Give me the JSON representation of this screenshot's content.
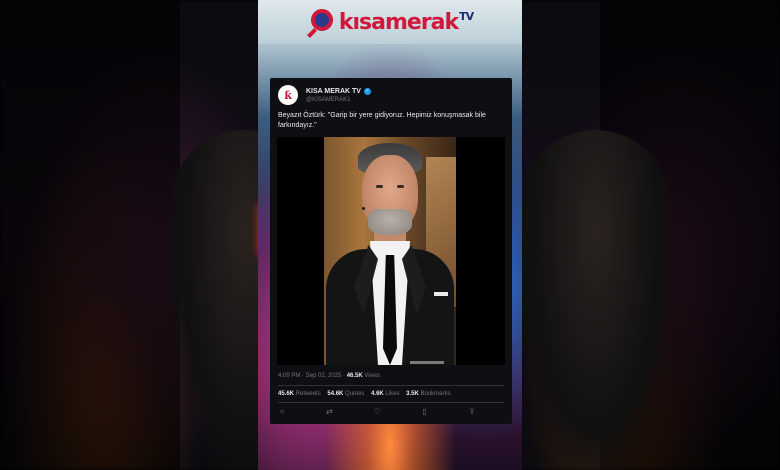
{
  "brand": {
    "logo_main": "kısamerak",
    "logo_suffix": "TV",
    "colors": {
      "navy": "#1d2a78",
      "red": "#d1173a"
    }
  },
  "tweet": {
    "avatar_letter": "ƙ",
    "display_name": "KISA MERAK TV",
    "verified": true,
    "handle": "@KISAMERAK1",
    "text": "Beyazıt Öztürk: \"Garip bir yere gidiyoruz. Hepimiz konuşmasak bile farkındayız.\"",
    "time": "4:09 PM · Sep 02, 2025 · ",
    "views_count": "46.5K",
    "views_label": " Views",
    "stats": {
      "retweets_count": "45.6K",
      "retweets_label": " Retweets",
      "quotes_count": "54.6K",
      "quotes_label": " Quotes",
      "likes_count": "4.6K",
      "likes_label": " Likes",
      "bookmarks_count": "3.5K",
      "bookmarks_label": " Bookmarks"
    },
    "actions": [
      {
        "name": "reply-icon",
        "glyph": "○"
      },
      {
        "name": "retweet-icon",
        "glyph": "⇄"
      },
      {
        "name": "like-icon",
        "glyph": "♡"
      },
      {
        "name": "bookmark-icon",
        "glyph": "▯"
      },
      {
        "name": "share-icon",
        "glyph": "⇧"
      }
    ]
  }
}
